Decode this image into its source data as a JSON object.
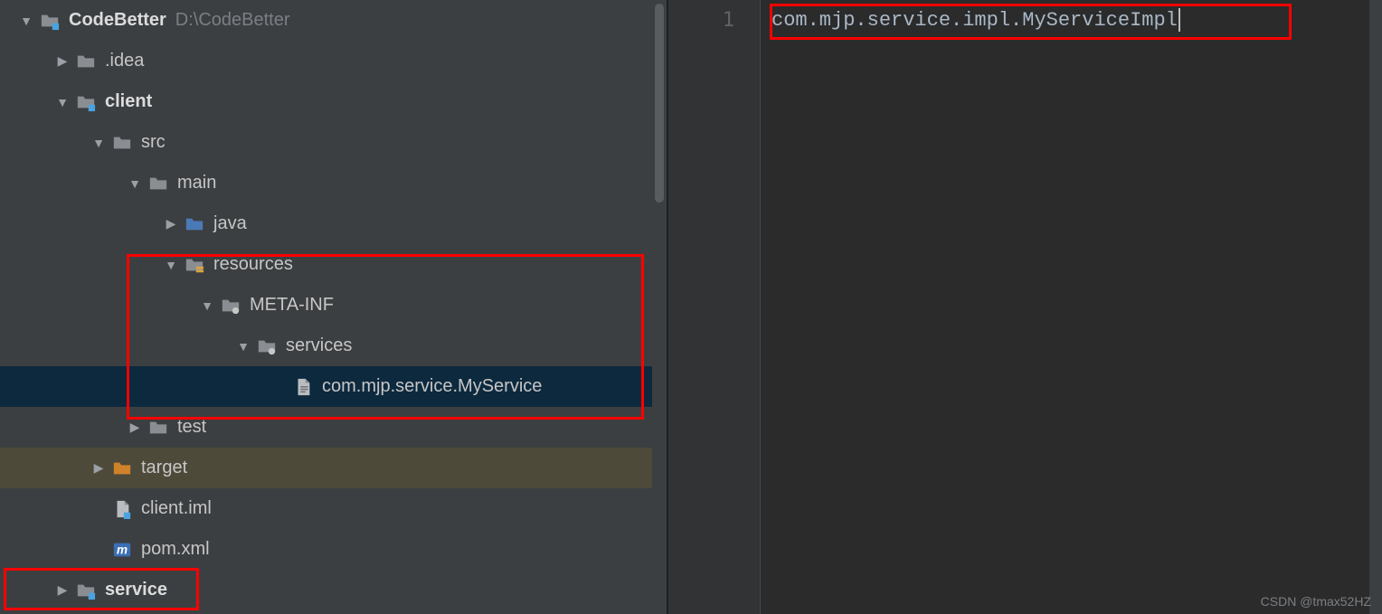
{
  "project": {
    "name": "CodeBetter",
    "path": "D:\\CodeBetter"
  },
  "tree": {
    "nodes": [
      {
        "depth": 0,
        "chev": "down",
        "icon": "project",
        "labelBold": "CodeBetter",
        "aux": "D:\\CodeBetter",
        "selected": false
      },
      {
        "depth": 1,
        "chev": "right",
        "icon": "folder",
        "label": ".idea"
      },
      {
        "depth": 1,
        "chev": "down",
        "icon": "module",
        "labelBold": "client"
      },
      {
        "depth": 2,
        "chev": "down",
        "icon": "folder",
        "label": "src"
      },
      {
        "depth": 3,
        "chev": "down",
        "icon": "folder",
        "label": "main"
      },
      {
        "depth": 4,
        "chev": "right",
        "icon": "src-folder",
        "label": "java"
      },
      {
        "depth": 4,
        "chev": "down",
        "icon": "res-folder",
        "label": "resources"
      },
      {
        "depth": 5,
        "chev": "down",
        "icon": "pkg-folder",
        "label": "META-INF"
      },
      {
        "depth": 6,
        "chev": "down",
        "icon": "pkg-folder",
        "label": "services"
      },
      {
        "depth": 7,
        "chev": "none",
        "icon": "file",
        "label": "com.mjp.service.MyService",
        "selected": true
      },
      {
        "depth": 3,
        "chev": "right",
        "icon": "folder",
        "label": "test"
      },
      {
        "depth": 2,
        "chev": "right",
        "icon": "target-folder",
        "label": "target",
        "hl": "target"
      },
      {
        "depth": 2,
        "chev": "none",
        "icon": "iml",
        "label": "client.iml"
      },
      {
        "depth": 2,
        "chev": "none",
        "icon": "maven",
        "label": "pom.xml"
      },
      {
        "depth": 1,
        "chev": "right",
        "icon": "module",
        "labelBold": "service"
      }
    ]
  },
  "editor": {
    "line_number": "1",
    "content": "com.mjp.service.impl.MyServiceImpl"
  },
  "watermark": "CSDN @tmax52HZ",
  "annotations": {
    "resources_box": true,
    "service_box": true,
    "editor_line_box": true
  }
}
